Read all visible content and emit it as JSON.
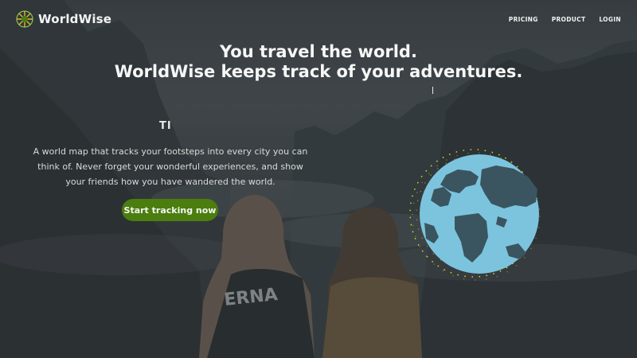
{
  "brand": {
    "name": "WorldWise",
    "logo_icon": "leaf-grid-logo-icon",
    "logo_color": "#8bc34a"
  },
  "nav": {
    "items": [
      "PRICING",
      "PRODUCT",
      "LOGIN"
    ]
  },
  "hero": {
    "headline_line1": "You travel the world.",
    "headline_line2": "WorldWise keeps track of your adventures.",
    "typing_text": "TI",
    "description": "A world map that tracks your footsteps into every city you can think of. Never forget your wonderful experiences, and show your friends how you have wandered the world.",
    "cta_label": "Start tracking now"
  },
  "colors": {
    "accent_green": "#4b7d0f",
    "globe_water": "#7cc4dd",
    "globe_land": "#3a5560",
    "orbit_dots": "#d9e021"
  }
}
